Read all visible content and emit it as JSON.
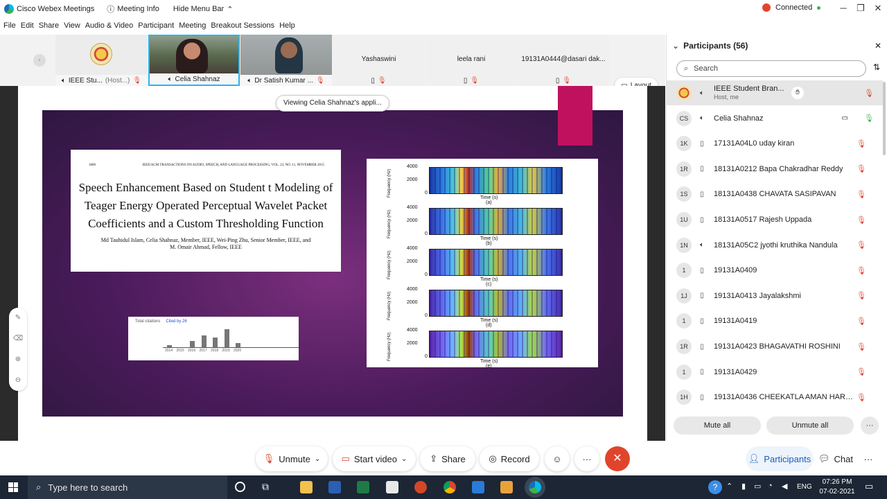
{
  "titlebar": {
    "app_name": "Cisco Webex Meetings",
    "meeting_info": "Meeting Info",
    "hide_menu": "Hide Menu Bar",
    "status": "Connected"
  },
  "menu": [
    "File",
    "Edit",
    "Share",
    "View",
    "Audio & Video",
    "Participant",
    "Meeting",
    "Breakout Sessions",
    "Help"
  ],
  "strip": {
    "tiles": [
      {
        "name": "IEEE Stu...",
        "role": "(Host...)"
      },
      {
        "name": "Celia Shahnaz"
      },
      {
        "name": "Dr Satish Kumar ..."
      },
      {
        "name": "Yashaswini"
      },
      {
        "name": "leela rani"
      },
      {
        "name": "19131A0444@dasari dak..."
      }
    ],
    "layout_label": "Layout"
  },
  "share": {
    "viewing_label": "Viewing Celia Shahnaz's appli...",
    "paper": {
      "page_num": "1800",
      "journal": "IEEE/ACM TRANSACTIONS ON AUDIO, SPEECH, AND LANGUAGE PROCESSING, VOL. 23, NO. 11, NOVEMBER 2015",
      "title_line1": "Speech Enhancement Based on Student t Modeling of",
      "title_line2": "Teager Energy Operated Perceptual Wavelet Packet",
      "title_line3": "Coefficients and a Custom Thresholding Function",
      "authors_line1": "Md Tauhidul Islam, Celia Shahnaz, Member, IEEE, Wei-Ping Zhu, Senior Member, IEEE, and",
      "authors_line2": "M. Omair Ahmad, Fellow, IEEE"
    },
    "citations": {
      "label": "Total citations",
      "cited_by": "Cited by 26",
      "years": [
        "2014",
        "2015",
        "2016",
        "2017",
        "2018",
        "2019",
        "2020"
      ],
      "values": [
        1,
        0,
        3,
        6,
        5,
        9,
        2
      ]
    },
    "spectrograms": {
      "ylabel": "Frequency (Hz)",
      "xlabel": "Time (s)",
      "yticks": [
        "4000",
        "2000",
        "0"
      ],
      "xticks": [
        "0",
        "1",
        "2"
      ],
      "panels": [
        "(a)",
        "(b)",
        "(c)",
        "(d)",
        "(e)"
      ]
    }
  },
  "controls": {
    "unmute": "Unmute",
    "start_video": "Start video",
    "share": "Share",
    "record": "Record",
    "participants": "Participants",
    "chat": "Chat"
  },
  "panel": {
    "title": "Participants (56)",
    "search_placeholder": "Search",
    "participants": [
      {
        "initials": "",
        "name": "IEEE Student Bran...",
        "sub": "Host, me"
      },
      {
        "initials": "CS",
        "name": "Celia Shahnaz"
      },
      {
        "initials": "1K",
        "name": "17131A04L0 uday kiran"
      },
      {
        "initials": "1R",
        "name": "18131A0212 Bapa Chakradhar Reddy"
      },
      {
        "initials": "1S",
        "name": "18131A0438 CHAVATA SASIPAVAN"
      },
      {
        "initials": "1U",
        "name": "18131A0517 Rajesh Uppada"
      },
      {
        "initials": "1N",
        "name": "18131A05C2 jyothi kruthika Nandula"
      },
      {
        "initials": "1",
        "name": "19131A0409"
      },
      {
        "initials": "1J",
        "name": "19131A0413 Jayalakshmi"
      },
      {
        "initials": "1",
        "name": "19131A0419"
      },
      {
        "initials": "1R",
        "name": "19131A0423 BHAGAVATHI ROSHINI"
      },
      {
        "initials": "1",
        "name": "19131A0429"
      },
      {
        "initials": "1H",
        "name": "19131A0436 CHEEKATLA AMAN HARS..."
      }
    ],
    "mute_all": "Mute all",
    "unmute_all": "Unmute all"
  },
  "taskbar": {
    "search_placeholder": "Type here to search",
    "lang": "ENG",
    "time": "07:26 PM",
    "date": "07-02-2021"
  }
}
